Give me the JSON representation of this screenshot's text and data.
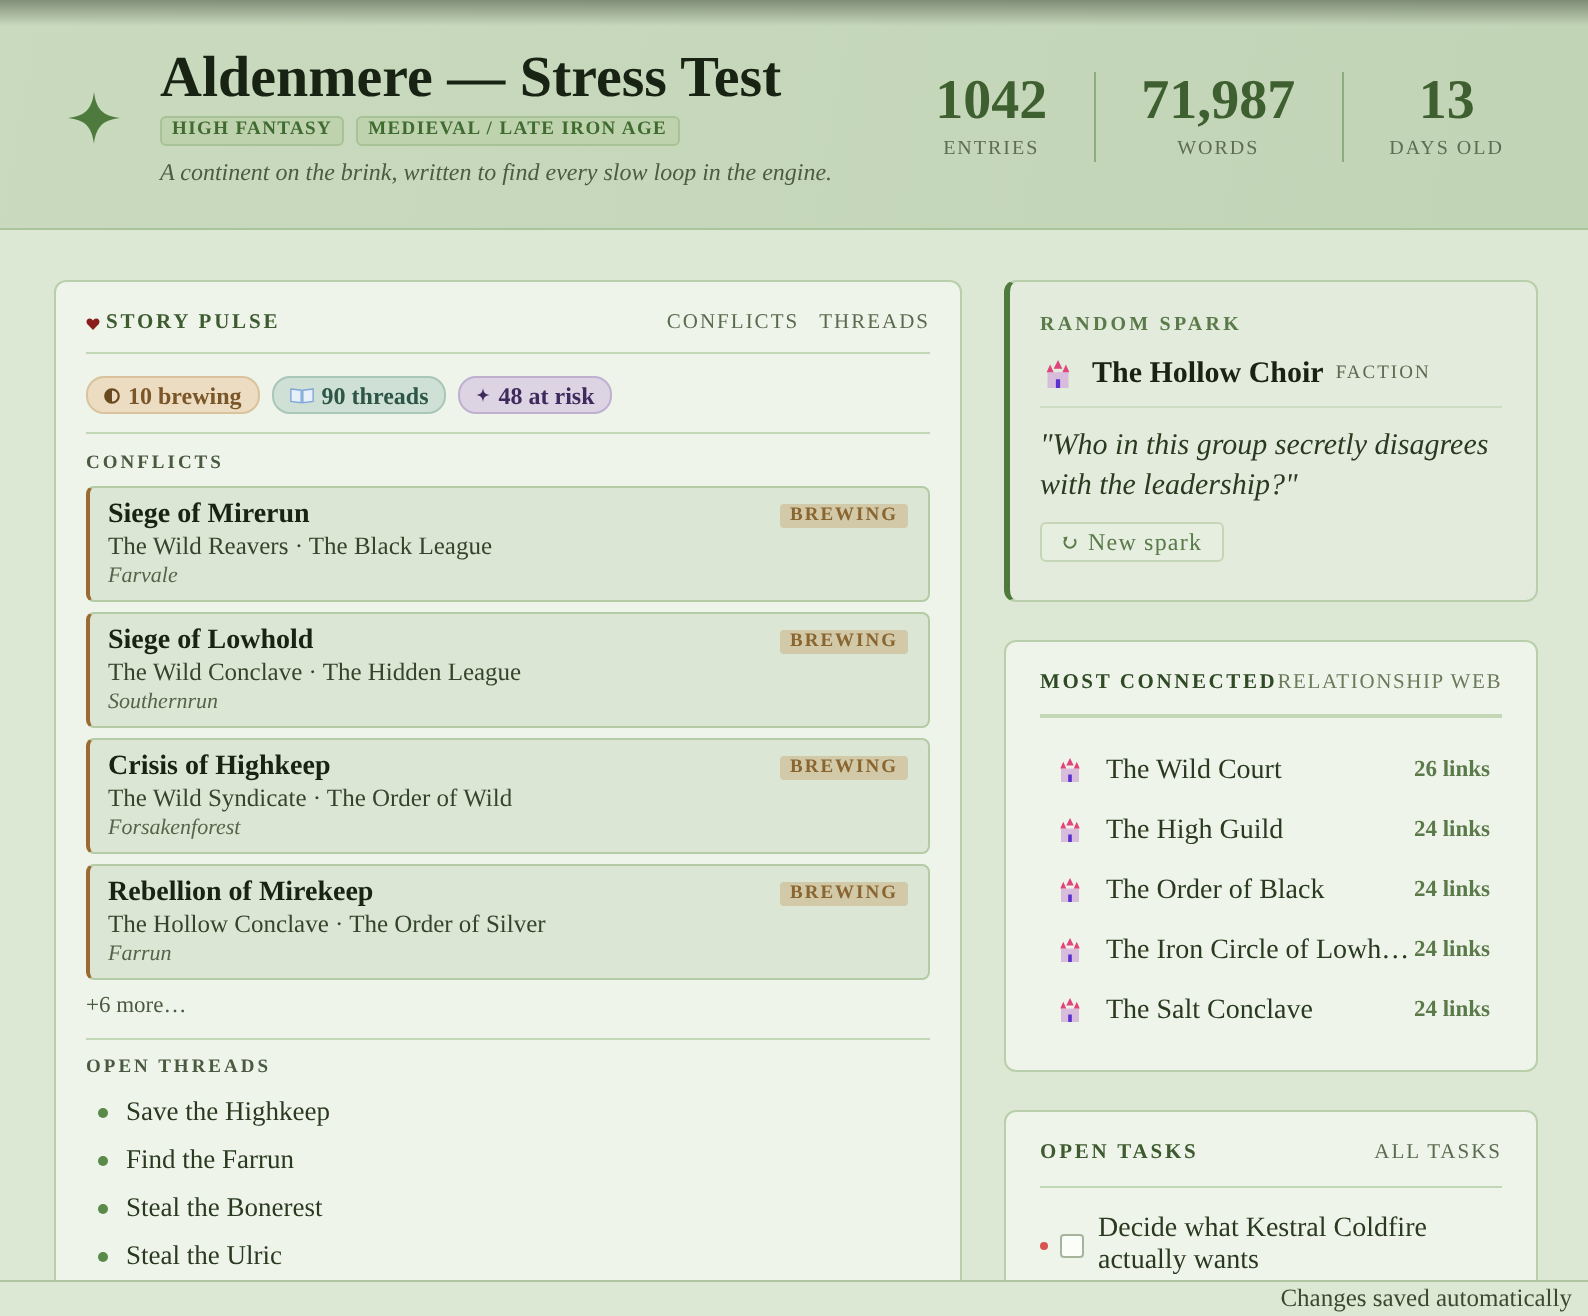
{
  "header": {
    "title": "Aldenmere — Stress Test",
    "tags": [
      "HIGH FANTASY",
      "MEDIEVAL / LATE IRON AGE"
    ],
    "subtitle": "A continent on the brink, written to find every slow loop in the engine.",
    "stats": [
      {
        "value": "1042",
        "label": "ENTRIES"
      },
      {
        "value": "71,987",
        "label": "WORDS"
      },
      {
        "value": "13",
        "label": "DAYS OLD"
      }
    ]
  },
  "story_pulse": {
    "title": "STORY PULSE",
    "links": [
      "CONFLICTS",
      "THREADS"
    ],
    "chips": [
      {
        "kind": "brewing",
        "label": "10 brewing"
      },
      {
        "kind": "threads",
        "label": "90 threads"
      },
      {
        "kind": "risk",
        "label": "48 at risk"
      }
    ],
    "conflicts_heading": "CONFLICTS",
    "conflicts": [
      {
        "title": "Siege of Mirerun",
        "factions": "The Wild Reavers · The Black League",
        "location": "Farvale",
        "status": "BREWING"
      },
      {
        "title": "Siege of Lowhold",
        "factions": "The Wild Conclave · The Hidden League",
        "location": "Southernrun",
        "status": "BREWING"
      },
      {
        "title": "Crisis of Highkeep",
        "factions": "The Wild Syndicate · The Order of Wild",
        "location": "Forsakenforest",
        "status": "BREWING"
      },
      {
        "title": "Rebellion of Mirekeep",
        "factions": "The Hollow Conclave · The Order of Silver",
        "location": "Farrun",
        "status": "BREWING"
      }
    ],
    "more": "+6 more…",
    "threads_heading": "OPEN THREADS",
    "threads": [
      "Save the Highkeep",
      "Find the Farrun",
      "Steal the Bonerest",
      "Steal the Ulric"
    ]
  },
  "random_spark": {
    "heading": "RANDOM SPARK",
    "entity": {
      "name": "The Hollow Choir",
      "type": "FACTION"
    },
    "prompt": "\"Who in this group secretly disagrees with the leadership?\"",
    "button": "New spark"
  },
  "most_connected": {
    "title": "MOST CONNECTED",
    "link": "RELATIONSHIP WEB",
    "items": [
      {
        "name": "The Wild Court",
        "links": "26 links"
      },
      {
        "name": "The High Guild",
        "links": "24 links"
      },
      {
        "name": "The Order of Black",
        "links": "24 links"
      },
      {
        "name": "The Iron Circle of Lowh…",
        "links": "24 links"
      },
      {
        "name": "The Salt Conclave",
        "links": "24 links"
      }
    ]
  },
  "open_tasks": {
    "title": "OPEN TASKS",
    "link": "ALL TASKS",
    "tasks": [
      {
        "text": "Decide what Kestral Coldfire actually wants",
        "checked": false,
        "color": "#d9534f"
      }
    ]
  },
  "status_bar": {
    "text": "Changes saved automatically"
  }
}
